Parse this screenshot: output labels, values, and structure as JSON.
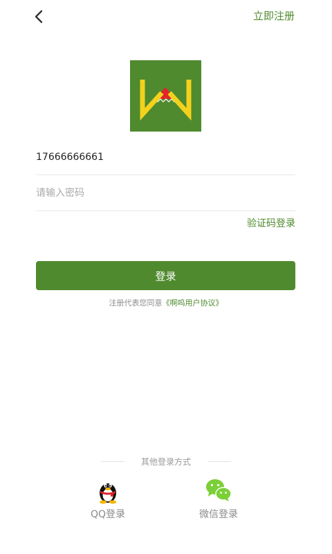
{
  "header": {
    "register_label": "立即注册"
  },
  "login_form": {
    "phone_value": "17666666661",
    "password_placeholder": "请输入密码",
    "sms_login_label": "验证码登录",
    "login_button_label": "登录",
    "agreement_prefix": "注册代表您同意",
    "agreement_link": "《啊呜用户协议》"
  },
  "other_login": {
    "title": "其他登录方式",
    "qq_label": "QQ登录",
    "wechat_label": "微信登录"
  },
  "colors": {
    "brand_green": "#4f8a2e",
    "logo_yellow": "#f3d21c",
    "logo_red": "#e0242a"
  }
}
